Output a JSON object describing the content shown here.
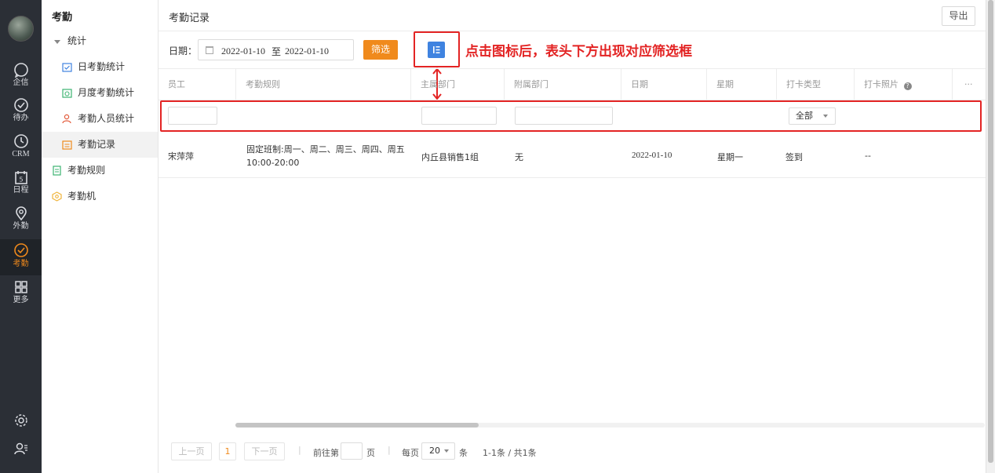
{
  "nav": {
    "items": [
      {
        "label": "企信",
        "icon": "chat-icon"
      },
      {
        "label": "待办",
        "icon": "check-circle-icon"
      },
      {
        "label": "CRM",
        "icon": "clock-icon"
      },
      {
        "label": "日程",
        "icon": "calendar-icon",
        "badge": "5"
      },
      {
        "label": "外勤",
        "icon": "location-icon"
      },
      {
        "label": "考勤",
        "icon": "attendance-icon"
      },
      {
        "label": "更多",
        "icon": "grid-icon"
      }
    ],
    "active_color": "#f08a1c"
  },
  "menu": {
    "title": "考勤",
    "items": [
      {
        "label": "统计",
        "icon": "caret-down-icon"
      },
      {
        "label": "日考勤统计",
        "icon": "daily-stat-icon"
      },
      {
        "label": "月度考勤统计",
        "icon": "monthly-stat-icon"
      },
      {
        "label": "考勤人员统计",
        "icon": "person-stat-icon"
      },
      {
        "label": "考勤记录",
        "icon": "record-icon"
      },
      {
        "label": "考勤规则",
        "icon": "rule-icon"
      },
      {
        "label": "考勤机",
        "icon": "device-icon"
      }
    ]
  },
  "header": {
    "title": "考勤记录",
    "export_label": "导出"
  },
  "filter": {
    "date_label": "日期：",
    "date_from": "2022-01-10",
    "date_to_sep": "至",
    "date_to": "2022-01-10",
    "filter_button": "筛选",
    "annotation": "点击图标后，表头下方出现对应筛选框"
  },
  "table": {
    "columns": [
      "员工",
      "考勤规则",
      "主属部门",
      "附属部门",
      "日期",
      "星期",
      "打卡类型",
      "打卡照片",
      "···"
    ],
    "clock_type_filter": "全部",
    "rows": [
      {
        "employee": "宋萍萍",
        "rule_line1": "固定班制:周一、周二、周三、周四、周五",
        "rule_line2": "10:00-20:00",
        "main_dept": "内丘县销售1组",
        "sub_dept": "无",
        "date": "2022-01-10",
        "weekday": "星期一",
        "clock_type": "签到",
        "photo": "--"
      }
    ]
  },
  "pagination": {
    "prev": "上一页",
    "current_page": "1",
    "next": "下一页",
    "goto_prefix": "前往第",
    "goto_suffix": "页",
    "per_page_label": "每页",
    "per_page": "20",
    "per_page_unit": "条",
    "summary": "1-1条 / 共1条"
  }
}
